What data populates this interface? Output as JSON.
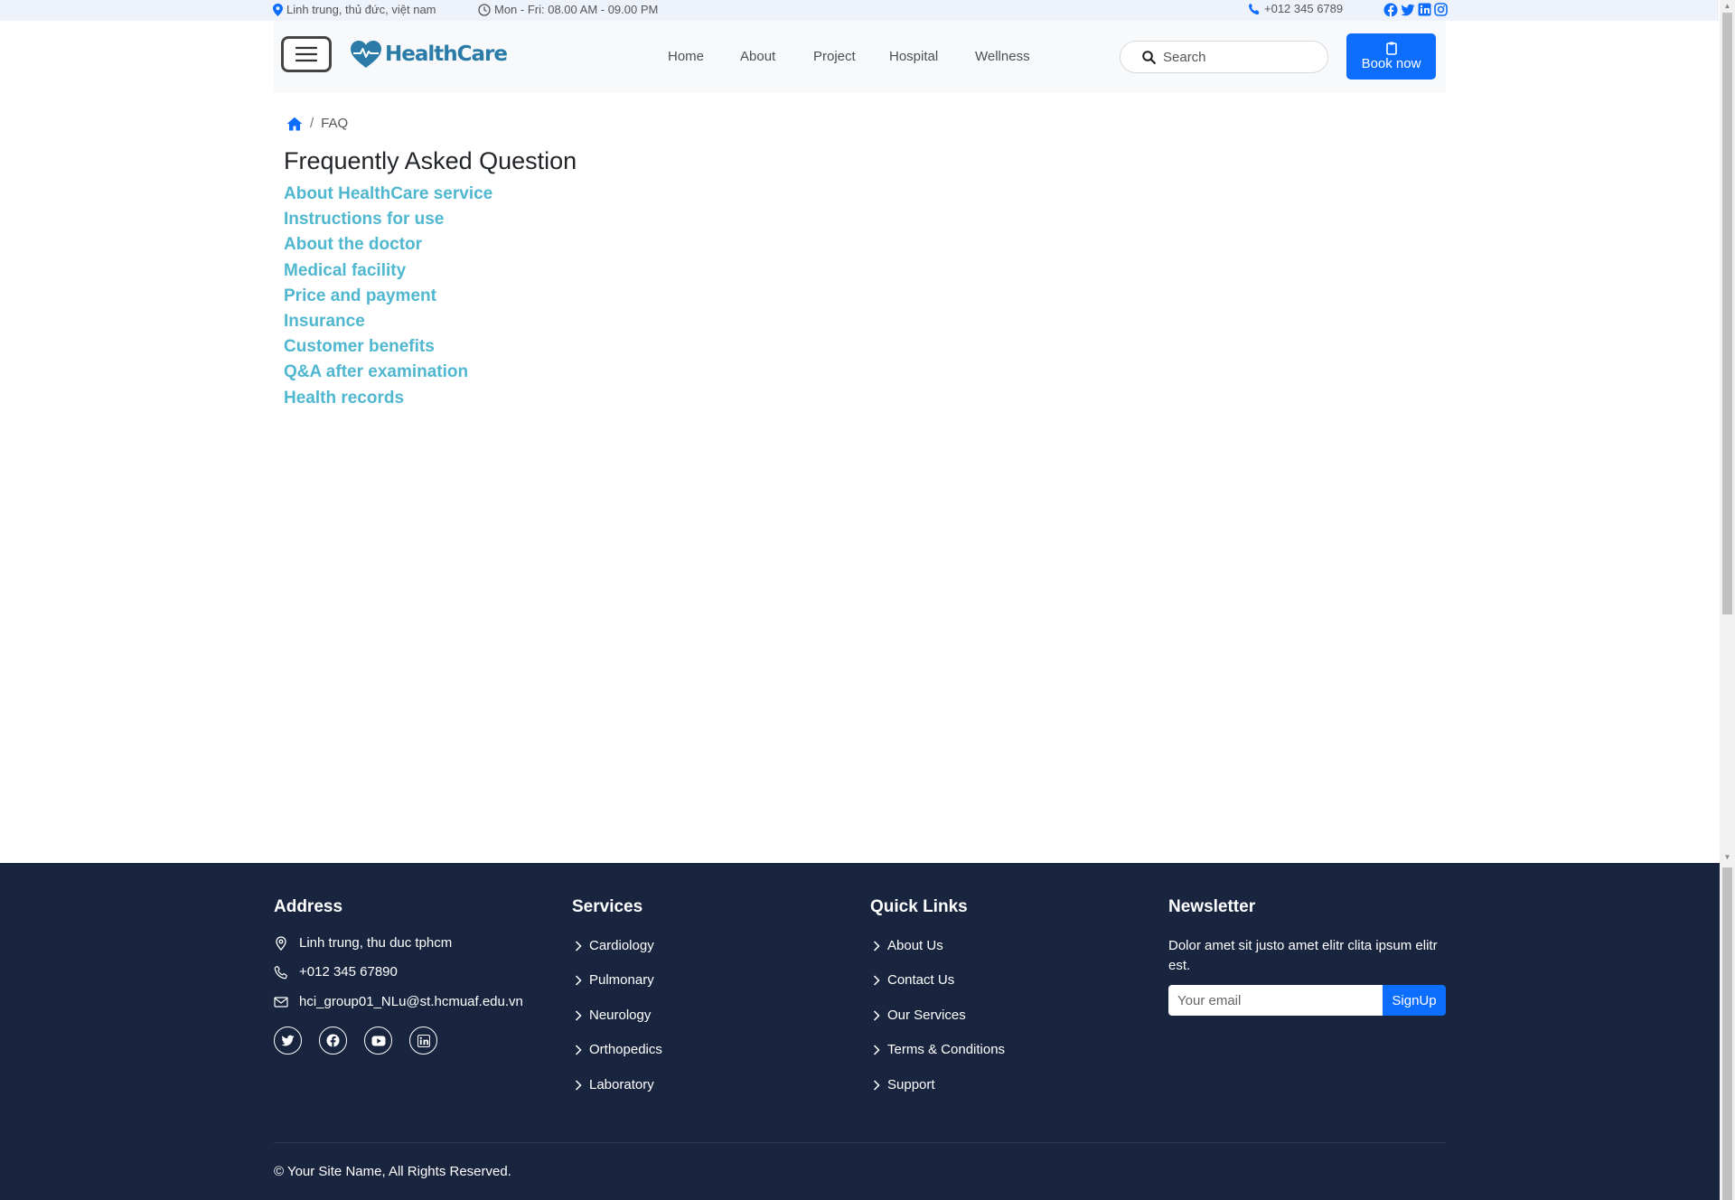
{
  "topbar": {
    "address": "Linh trung, thủ đức, việt nam",
    "hours": "Mon - Fri: 08.00 AM - 09.00 PM",
    "phone": "+012 345 6789",
    "social_icons": [
      "facebook-icon",
      "twitter-icon",
      "linkedin-icon",
      "instagram-icon"
    ]
  },
  "header": {
    "logo_text": "HealthCare",
    "nav": [
      {
        "label": "Home"
      },
      {
        "label": "About"
      },
      {
        "label": "Project"
      },
      {
        "label": "Hospital"
      },
      {
        "label": "Wellness"
      }
    ],
    "search_placeholder": "Search",
    "book_label": "Book now"
  },
  "breadcrumb": {
    "separator": "/",
    "current": "FAQ"
  },
  "main": {
    "title": "Frequently Asked Question",
    "faq_topics": [
      "About HealthCare service",
      "Instructions for use",
      "About the doctor",
      "Medical facility",
      "Price and payment",
      "Insurance",
      "Customer benefits",
      "Q&A after examination",
      "Health records"
    ]
  },
  "footer": {
    "address": {
      "heading": "Address",
      "location": "Linh trung, thu duc tphcm",
      "phone": "+012 345 67890",
      "email": "hci_group01_NLu@st.hcmuaf.edu.vn"
    },
    "services": {
      "heading": "Services",
      "links": [
        "Cardiology",
        "Pulmonary",
        "Neurology",
        "Orthopedics",
        "Laboratory"
      ]
    },
    "quick_links": {
      "heading": "Quick Links",
      "links": [
        "About Us",
        "Contact Us",
        "Our Services",
        "Terms & Conditions",
        "Support"
      ]
    },
    "newsletter": {
      "heading": "Newsletter",
      "text": "Dolor amet sit justo amet elitr clita ipsum elitr est.",
      "email_placeholder": "Your email",
      "signup_label": "SignUp"
    },
    "copyright": "© Your Site Name, All Rights Reserved."
  },
  "colors": {
    "primary": "#0d6efd",
    "faq_link": "#4fb7cf",
    "logo": "#2a7ba8",
    "footer_bg": "#19253f",
    "topbar_bg": "#eef3fb"
  }
}
